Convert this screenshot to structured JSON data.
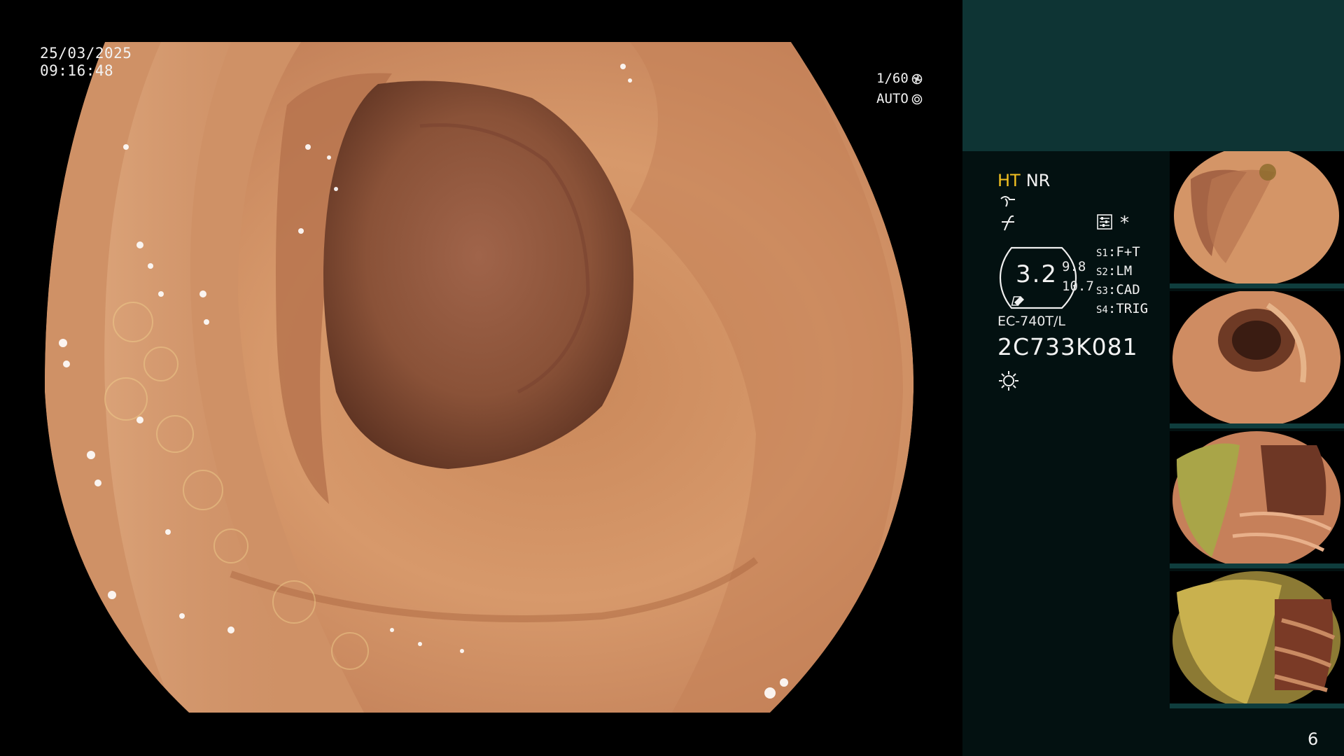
{
  "overlay": {
    "date": "25/03/2025",
    "time": "09:16:48",
    "shutter": "1/60",
    "shutter_icon": "shutter-icon",
    "iris": "AUTO",
    "iris_icon": "iris-icon"
  },
  "panel": {
    "mode_ht": "HT",
    "mode_nr": "NR",
    "mode_ht_color": "#f2c021",
    "panel_top_color": "#0e3434",
    "panel_color": "#031111",
    "zoom": "3.2",
    "zoom_a": "9.8",
    "zoom_b": "10.7",
    "switches": [
      {
        "key": "S1",
        "value": "F+T"
      },
      {
        "key": "S2",
        "value": "LM"
      },
      {
        "key": "S3",
        "value": "CAD"
      },
      {
        "key": "S4",
        "value": "TRIG"
      }
    ],
    "star": "*",
    "scope_model": "EC-740T/L",
    "scope_serial": "2C733K081",
    "icons": [
      "enhancement-icon",
      "color-icon",
      "settings-icon",
      "lamp-icon"
    ]
  },
  "thumbnails": [
    {
      "name": "capture-1"
    },
    {
      "name": "capture-2"
    },
    {
      "name": "capture-3"
    },
    {
      "name": "capture-4"
    }
  ],
  "page_number": "6"
}
